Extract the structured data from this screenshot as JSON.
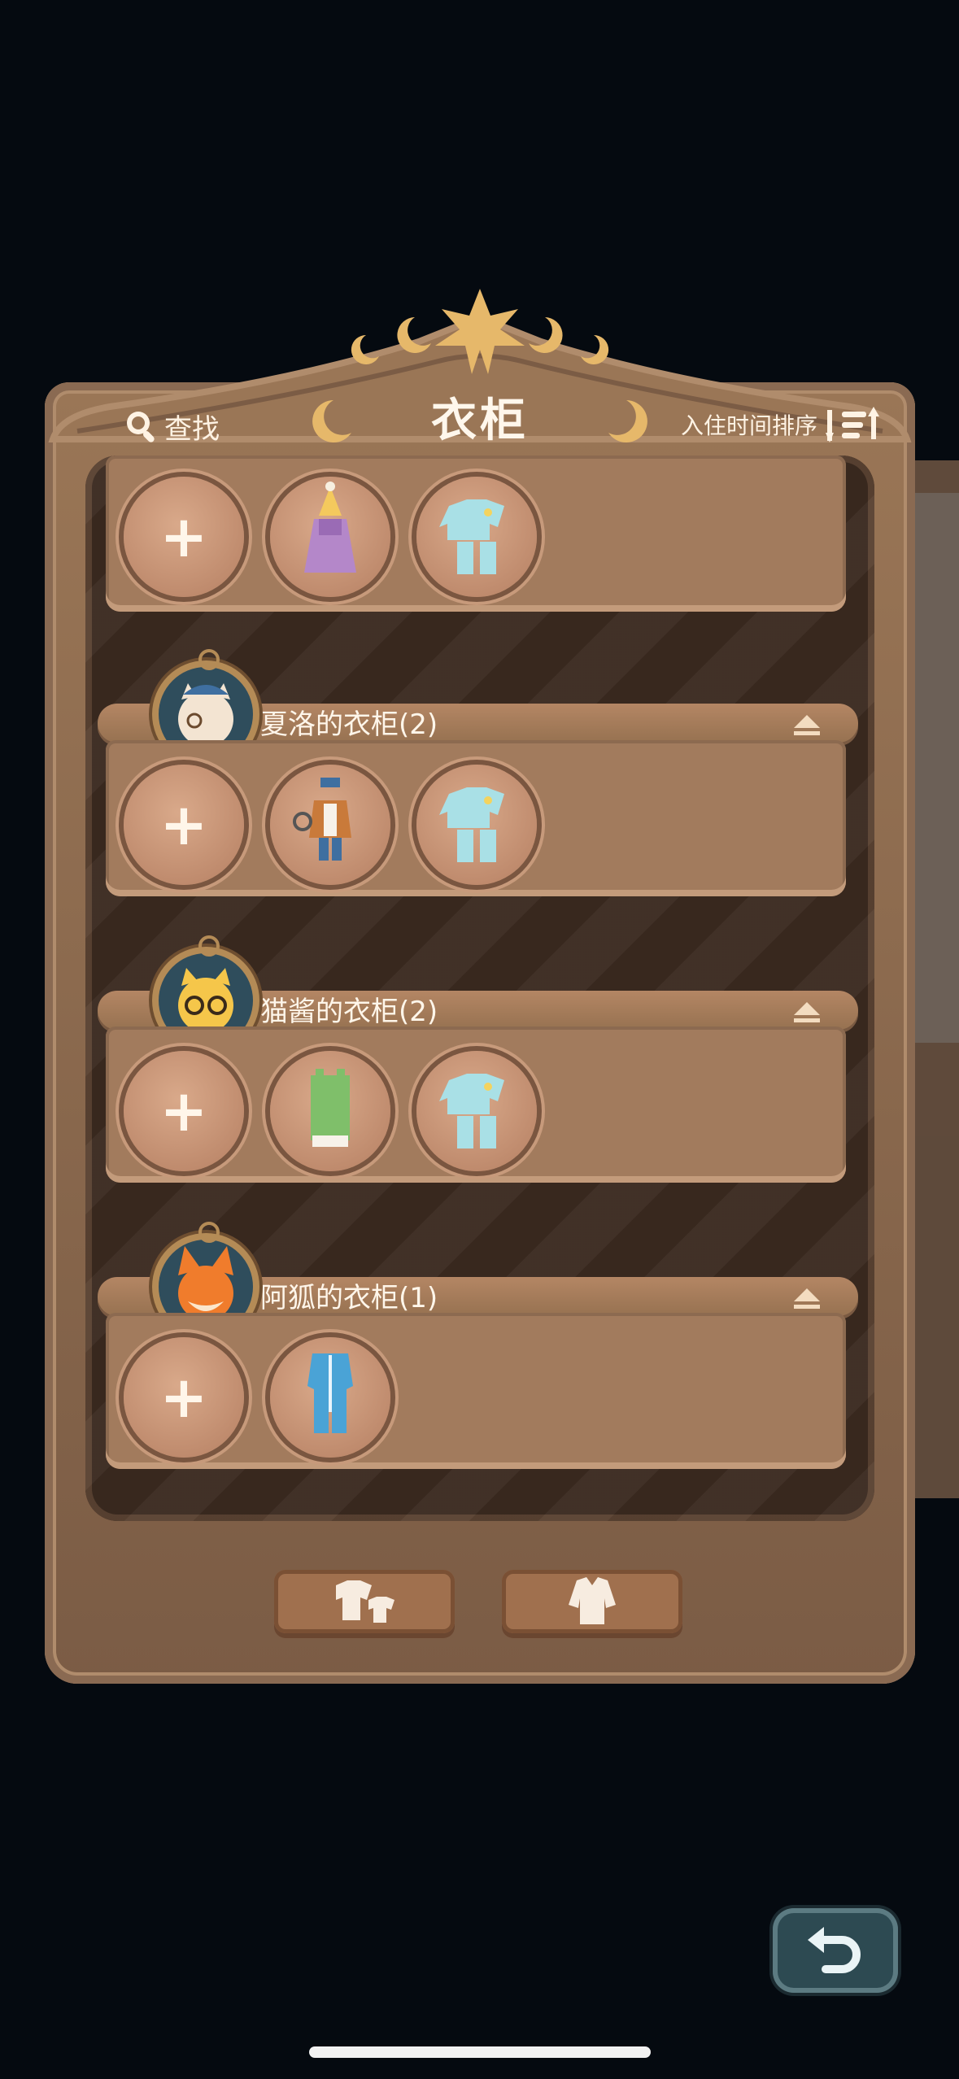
{
  "header": {
    "search_label": "查找",
    "title": "衣柜",
    "sort_label": "入住时间排序"
  },
  "wardrobes": [
    {
      "title": "",
      "items": [
        "add",
        "party-dress-icon",
        "pajamas-icon"
      ]
    },
    {
      "title": "夏洛的衣柜(2)",
      "avatar": "detective-cat-avatar",
      "items": [
        "add",
        "detective-outfit-icon",
        "pajamas-icon"
      ]
    },
    {
      "title": "猫酱的衣柜(2)",
      "avatar": "glasses-cat-avatar",
      "items": [
        "add",
        "green-overalls-icon",
        "pajamas-icon"
      ]
    },
    {
      "title": "阿狐的衣柜(1)",
      "avatar": "fox-avatar",
      "items": [
        "add",
        "blue-jumpsuit-icon"
      ]
    }
  ],
  "add_symbol": "+",
  "footer": {
    "left_button_icon": "outfits-icon",
    "right_button_icon": "coat-icon"
  },
  "colors": {
    "background": "#050a10",
    "wood": "#9a7656",
    "shelf": "#a27b5d",
    "slot": "#c6926f",
    "text": "#fff6ea",
    "back_button": "#2d4a52"
  }
}
